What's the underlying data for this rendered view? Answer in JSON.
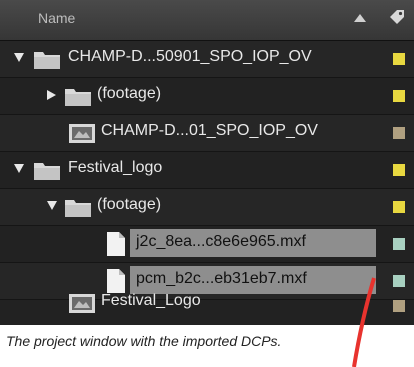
{
  "header": {
    "name_label": "Name",
    "sort_icon": "sort-up-icon",
    "label_icon": "tag-icon"
  },
  "rows": [
    {
      "label": "CHAMP-D...50901_SPO_IOP_OV",
      "type": "folder",
      "expanded": true,
      "color": "#e8d840"
    },
    {
      "label": "(footage)",
      "type": "folder",
      "expanded": false,
      "color": "#e8d840"
    },
    {
      "label": "CHAMP-D...01_SPO_IOP_OV",
      "type": "composition",
      "color": "#b0a080"
    },
    {
      "label": "Festival_logo",
      "type": "folder",
      "expanded": true,
      "color": "#e8d840"
    },
    {
      "label": "(footage)",
      "type": "folder",
      "expanded": true,
      "color": "#e8d840"
    },
    {
      "label": "j2c_8ea...c8e6e965.mxf",
      "type": "file",
      "selected": true,
      "color": "#a8d0c0"
    },
    {
      "label": "pcm_b2c...eb31eb7.mxf",
      "type": "file",
      "selected": true,
      "color": "#a8d0c0"
    },
    {
      "label": "Festival_Logo",
      "type": "composition",
      "color": "#b0a080"
    }
  ],
  "caption": "The project window with the imported DCPs."
}
